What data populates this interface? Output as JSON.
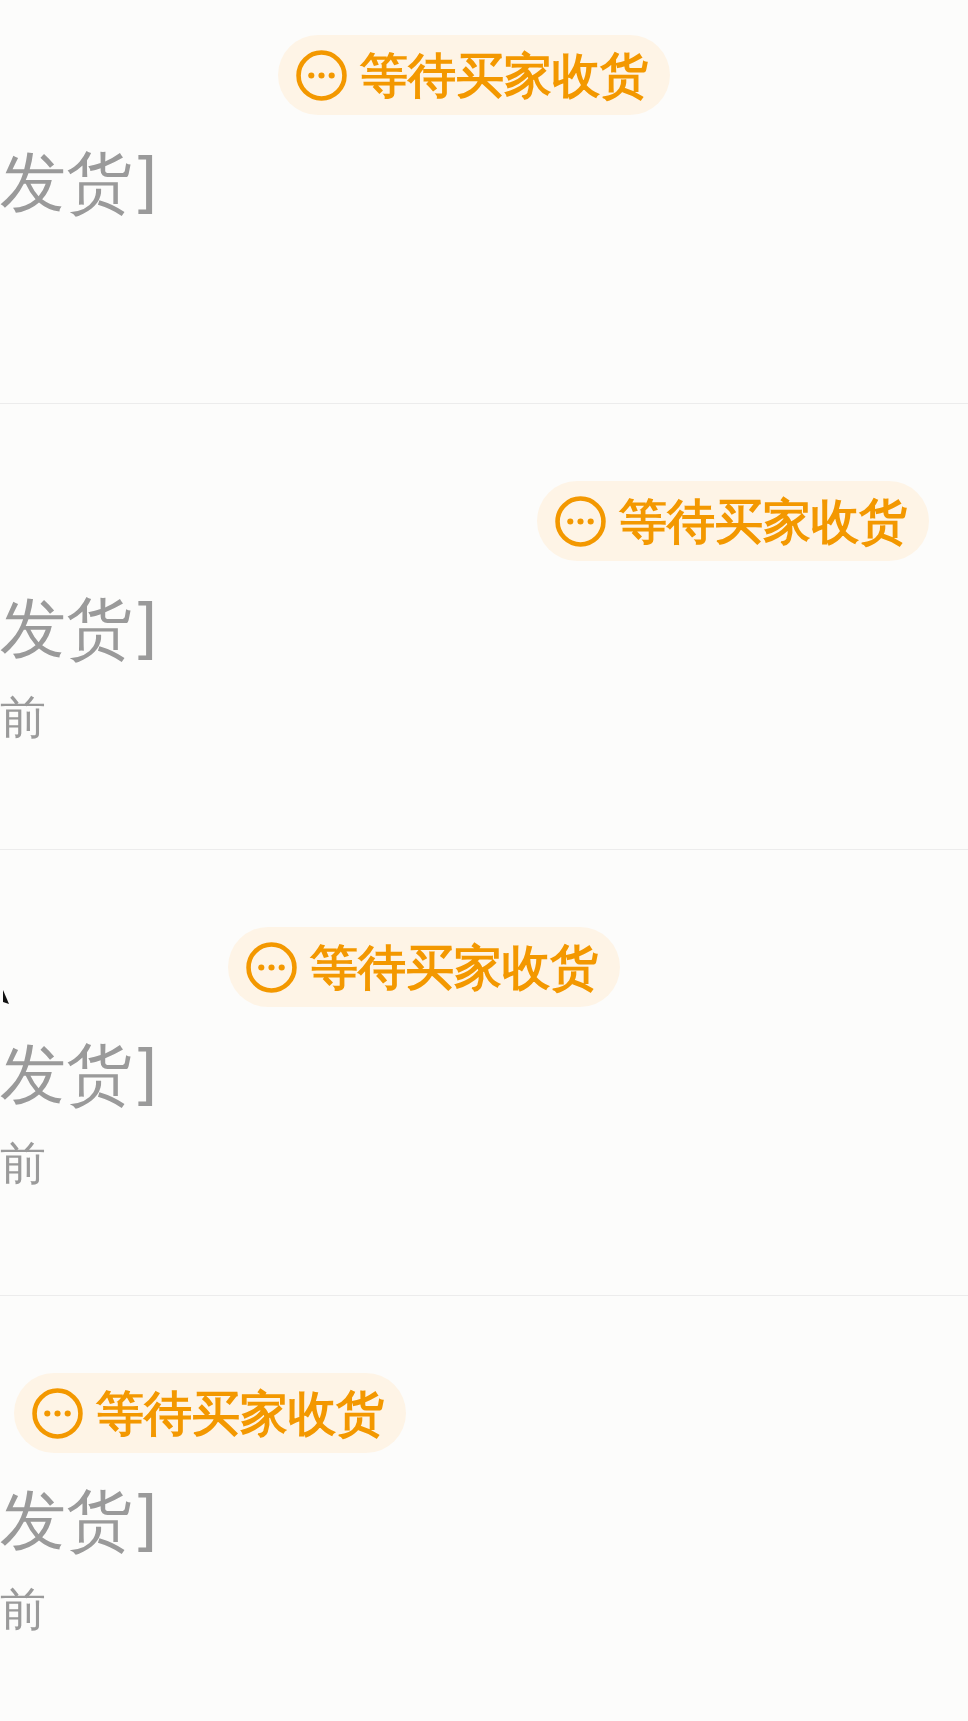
{
  "orders": [
    {
      "status": {
        "label": "等待买家收货"
      },
      "title": "发货]"
    },
    {
      "status": {
        "label": "等待买家收货"
      },
      "title": "发货]",
      "time": "前"
    },
    {
      "status": {
        "label": "等待买家收货"
      },
      "title": "发货]",
      "time": "前"
    },
    {
      "status": {
        "label": "等待买家收货"
      },
      "title": "发货]",
      "time": "前"
    }
  ]
}
